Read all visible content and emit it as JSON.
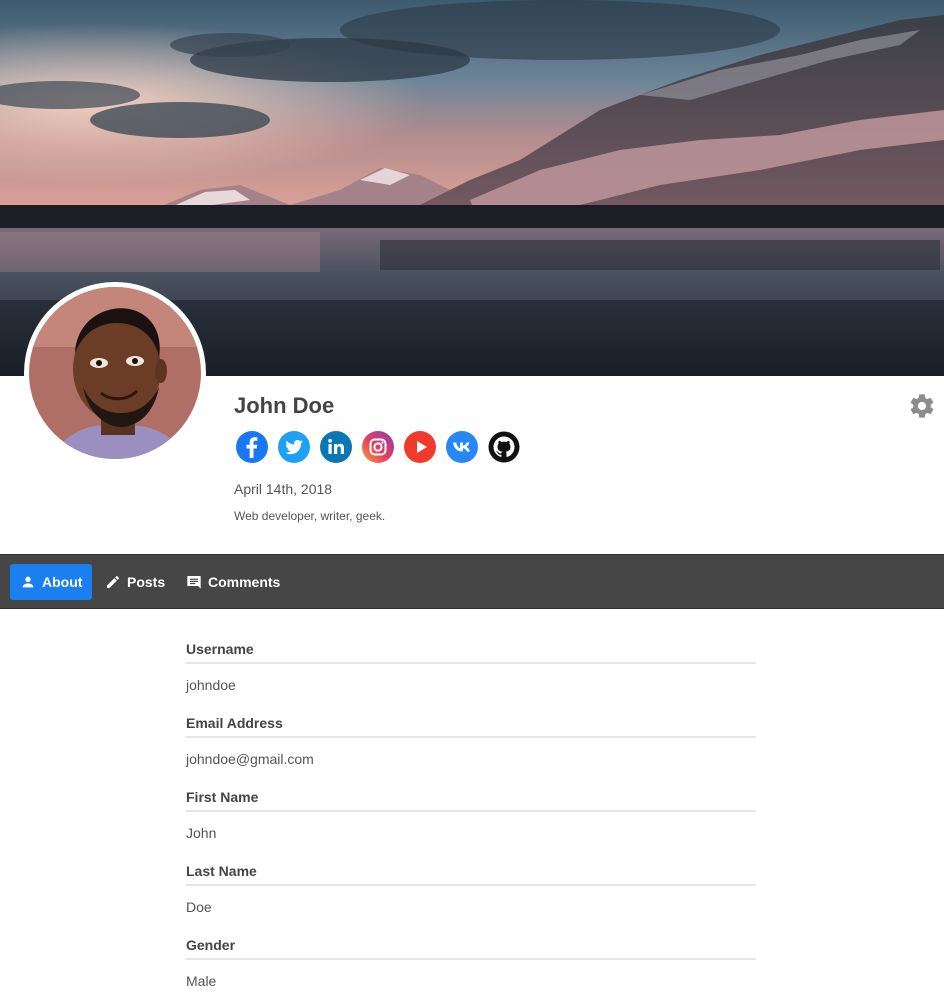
{
  "profile": {
    "name": "John Doe",
    "date": "April 14th, 2018",
    "bio": "Web developer, writer, geek."
  },
  "socials": [
    {
      "name": "facebook",
      "icon": "facebook-icon",
      "color": "#1877f2"
    },
    {
      "name": "twitter",
      "icon": "twitter-icon",
      "color": "#1da1f2"
    },
    {
      "name": "linkedin",
      "icon": "linkedin-icon",
      "color": "#0a77b5"
    },
    {
      "name": "instagram",
      "icon": "instagram-icon",
      "color": "#c13584"
    },
    {
      "name": "youtube",
      "icon": "youtube-icon",
      "color": "#f03a2e"
    },
    {
      "name": "vk",
      "icon": "vk-icon",
      "color": "#2787f5"
    },
    {
      "name": "github",
      "icon": "github-icon",
      "color": "#111111"
    }
  ],
  "nav": {
    "tabs": [
      {
        "label": "About",
        "icon": "person-icon",
        "active": true
      },
      {
        "label": "Posts",
        "icon": "pencil-icon",
        "active": false
      },
      {
        "label": "Comments",
        "icon": "comment-icon",
        "active": false
      }
    ]
  },
  "fields": [
    {
      "label": "Username",
      "value": "johndoe"
    },
    {
      "label": "Email Address",
      "value": "johndoe@gmail.com"
    },
    {
      "label": "First Name",
      "value": "John"
    },
    {
      "label": "Last Name",
      "value": "Doe"
    },
    {
      "label": "Gender",
      "value": "Male"
    }
  ],
  "colors": {
    "accent": "#1a7ff0",
    "navbar": "#464646"
  }
}
